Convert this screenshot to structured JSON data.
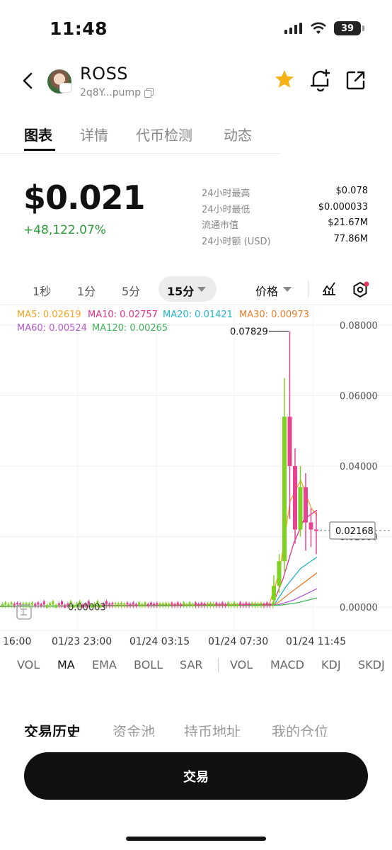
{
  "status": {
    "time": "11:48",
    "battery": "39"
  },
  "header": {
    "token_name": "ROSS",
    "address": "2q8Y...pump"
  },
  "tabs": [
    {
      "label": "图表",
      "active": true
    },
    {
      "label": "详情"
    },
    {
      "label": "代币检测"
    },
    {
      "label": "动态"
    }
  ],
  "price": {
    "value": "$0.021",
    "change": "+48,122.07%"
  },
  "stats": [
    {
      "label": "24小时最高",
      "value": "$0.078"
    },
    {
      "label": "24小时最低",
      "value": "$0.000033"
    },
    {
      "label": "流通市值",
      "value": "$21.67M"
    },
    {
      "label": "24小时额 (USD)",
      "value": "77.86M"
    }
  ],
  "timeframes": [
    "1秒",
    "1分",
    "5分",
    "15分"
  ],
  "active_timeframe": "15分",
  "price_selector": "价格",
  "ma_legend": [
    {
      "label": "MA5: 0.02619",
      "color": "#f5a623"
    },
    {
      "label": "MA10: 0.02757",
      "color": "#e0338a"
    },
    {
      "label": "MA20: 0.01421",
      "color": "#1fb6c9"
    },
    {
      "label": "MA30: 0.00973",
      "color": "#f07d28"
    },
    {
      "label": "MA60: 0.00524",
      "color": "#b65ad6"
    },
    {
      "label": "MA120: 0.00265",
      "color": "#3eb55a"
    }
  ],
  "chart_data": {
    "type": "candlestick",
    "y_ticks": [
      "0.08000",
      "0.06000",
      "0.04000",
      "0.02000",
      "0.00000"
    ],
    "x_ticks": [
      "16:00",
      "01/23 23:00",
      "01/24 03:15",
      "01/24 07:30",
      "01/24 11:45"
    ],
    "high_label": "0.07829",
    "low_label": "0.00003",
    "current_price_label": "0.02168",
    "ylim": [
      0,
      0.08
    ],
    "candles_tail": [
      {
        "o": 0.002,
        "h": 0.009,
        "c": 0.006,
        "l": 0.001
      },
      {
        "o": 0.006,
        "h": 0.015,
        "c": 0.013,
        "l": 0.004
      },
      {
        "o": 0.013,
        "h": 0.065,
        "c": 0.054,
        "l": 0.01
      },
      {
        "o": 0.054,
        "h": 0.0783,
        "c": 0.04,
        "l": 0.025
      },
      {
        "o": 0.04,
        "h": 0.045,
        "c": 0.022,
        "l": 0.018
      },
      {
        "o": 0.022,
        "h": 0.04,
        "c": 0.034,
        "l": 0.02
      },
      {
        "o": 0.034,
        "h": 0.038,
        "c": 0.024,
        "l": 0.016
      },
      {
        "o": 0.024,
        "h": 0.028,
        "c": 0.022,
        "l": 0.017
      },
      {
        "o": 0.022,
        "h": 0.027,
        "c": 0.0217,
        "l": 0.015
      }
    ],
    "grid": true
  },
  "indicators_main": [
    "VOL",
    "MA",
    "EMA",
    "BOLL",
    "SAR"
  ],
  "indicators_sub": [
    "VOL",
    "MACD",
    "KDJ",
    "SKDJ"
  ],
  "active_indicator": "MA",
  "bottom_tabs": [
    "交易历史",
    "资金池",
    "持币地址",
    "我的仓位"
  ],
  "trade_button": "交易",
  "colors": {
    "up": "#7ed321",
    "down": "#e84393",
    "positive": "#2a9d3a"
  }
}
